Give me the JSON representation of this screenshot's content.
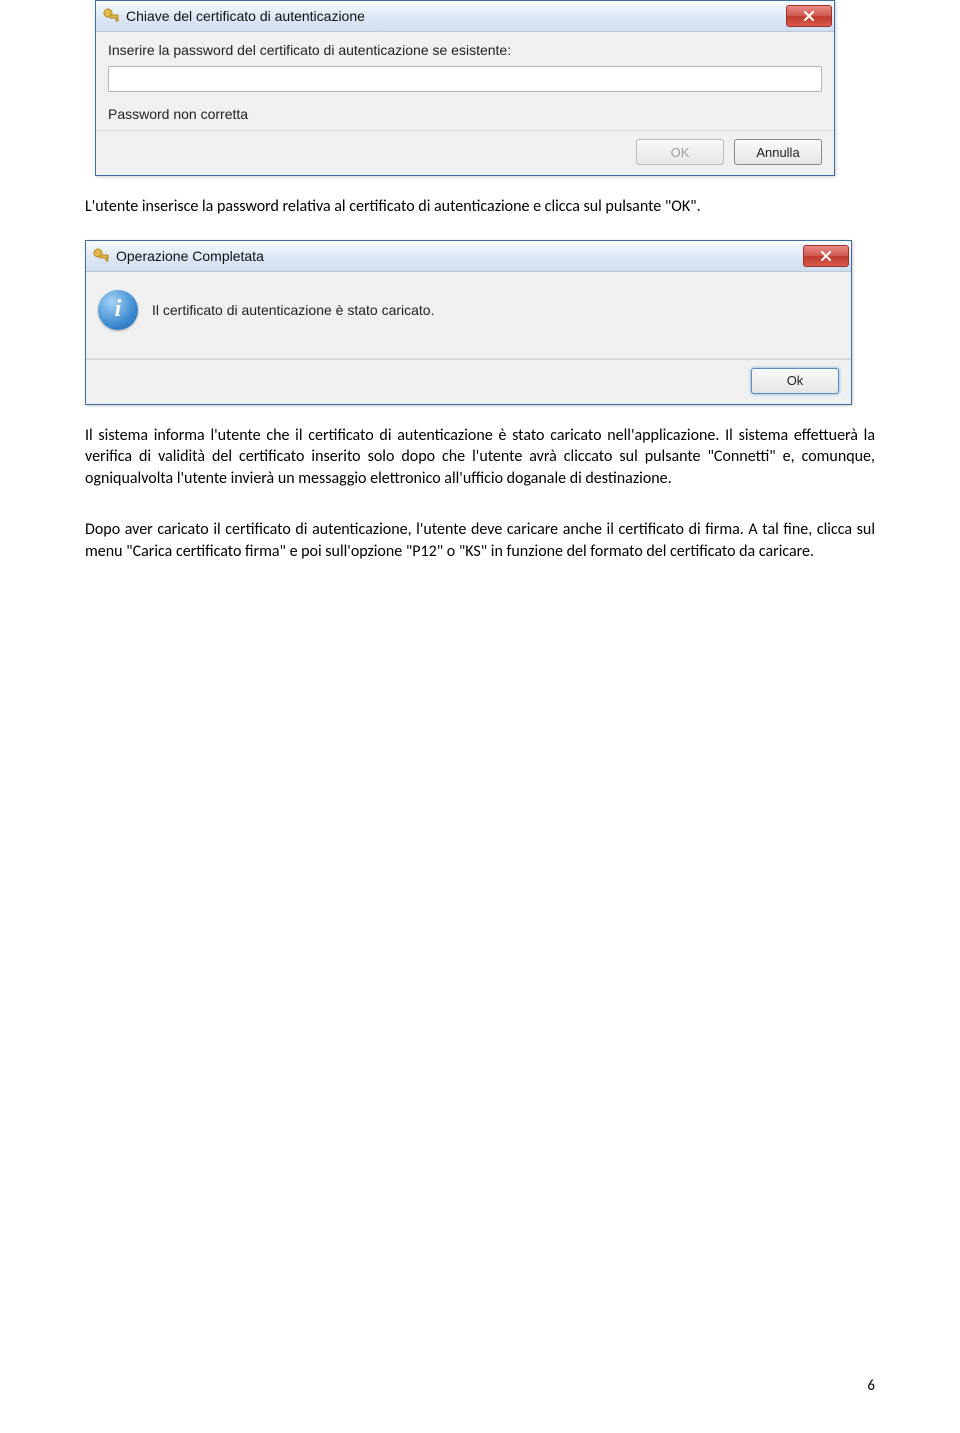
{
  "dialog1": {
    "title": "Chiave del certificato di autenticazione",
    "key_icon": "key-icon",
    "prompt": "Inserire la password del certificato di autenticazione se esistente:",
    "password_value": "",
    "error": "Password non corretta",
    "ok_label": "OK",
    "cancel_label": "Annulla"
  },
  "para1": "L'utente inserisce la password relativa al certificato di autenticazione e clicca sul pulsante \"OK\".",
  "dialog2": {
    "title": "Operazione Completata",
    "key_icon": "key-icon",
    "message": "Il certificato di autenticazione è stato caricato.",
    "ok_label": "Ok"
  },
  "para2": "Il sistema informa l'utente che il certificato di autenticazione è stato caricato nell'applicazione. Il sistema effettuerà la verifica di validità del certificato inserito solo dopo che l'utente avrà cliccato sul pulsante \"Connetti\" e, comunque, ogniqualvolta l'utente invierà un messaggio elettronico all'ufficio doganale di destinazione.",
  "para3": "Dopo aver caricato il certificato di autenticazione, l'utente deve caricare anche il certificato di firma. A tal fine, clicca sul menu \"Carica certificato firma\" e poi sull'opzione \"P12\" o \"KS\" in funzione del formato del certificato da caricare.",
  "page_number": "6"
}
